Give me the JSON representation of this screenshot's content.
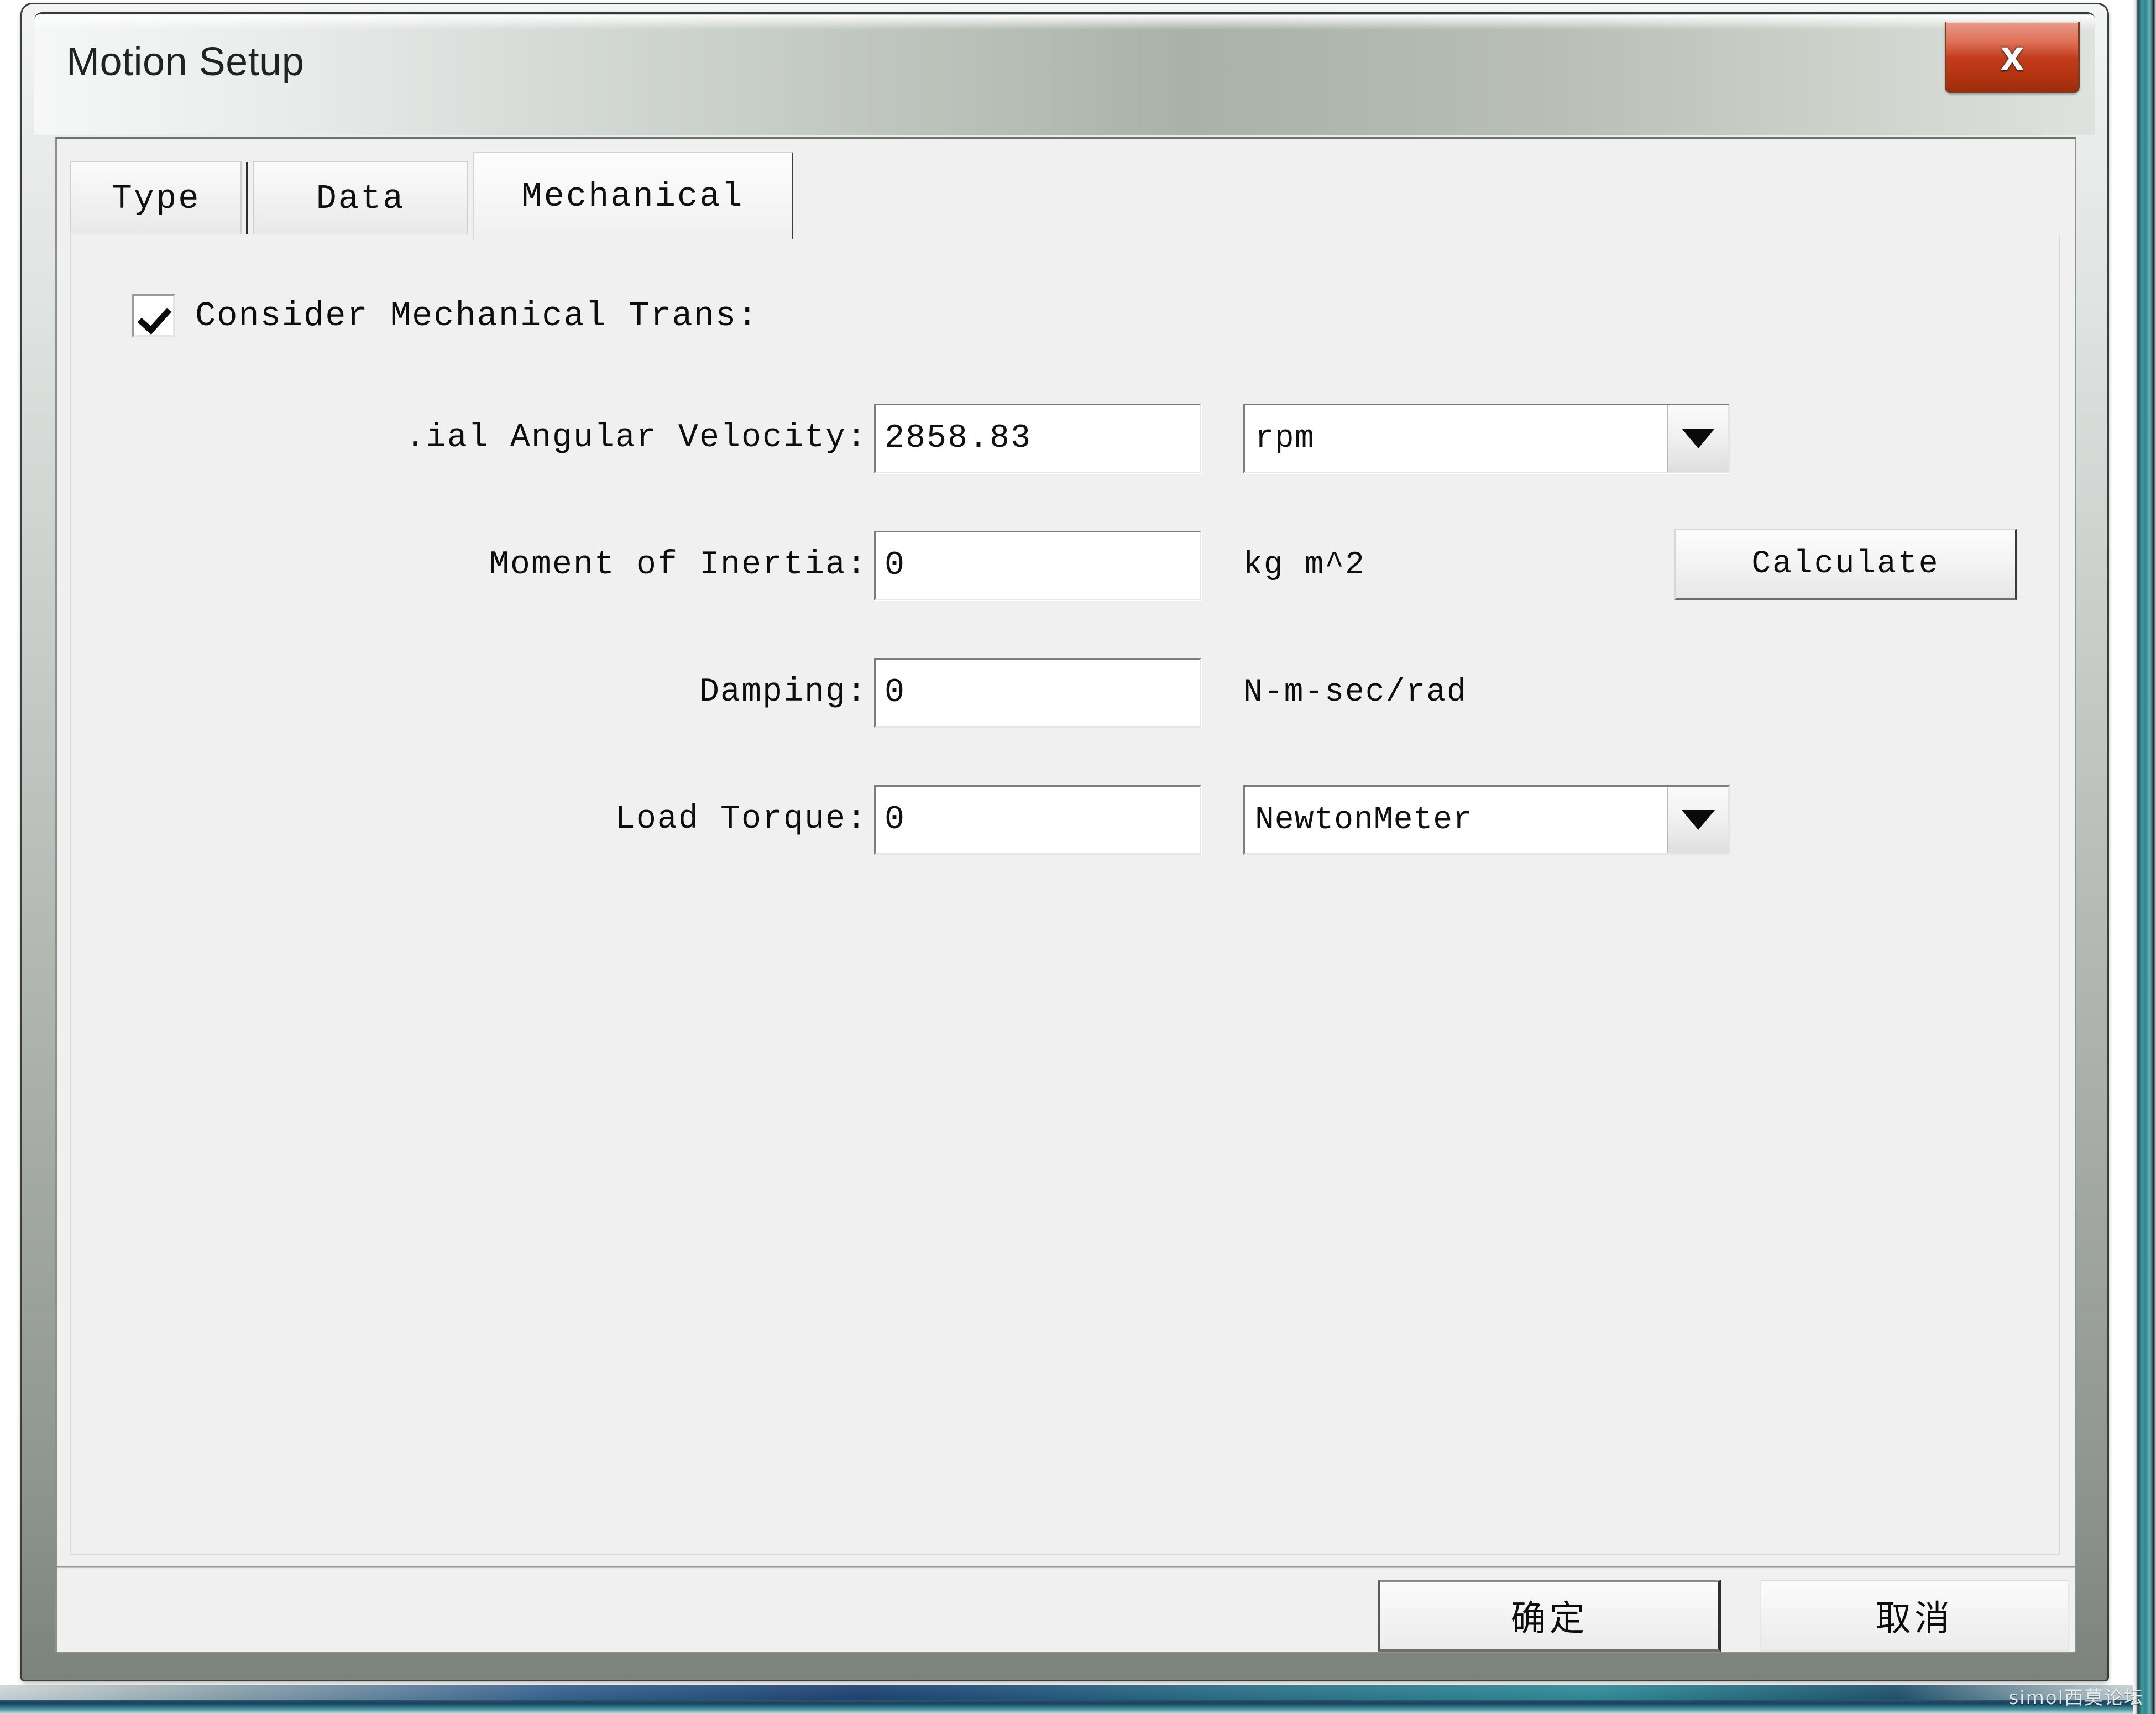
{
  "window": {
    "title": "Motion Setup",
    "close_glyph": "x",
    "close_label": "Close"
  },
  "tabs": [
    {
      "label": "Type",
      "active": false
    },
    {
      "label": "Data",
      "active": false
    },
    {
      "label": "Mechanical",
      "active": true
    }
  ],
  "mechanical": {
    "consider_checkbox": {
      "label": "Consider Mechanical Trans:",
      "checked": true
    },
    "rows": [
      {
        "label": ".ial Angular Velocity:",
        "value": "2858.83",
        "unit_kind": "combo",
        "unit": "rpm"
      },
      {
        "label": "Moment of Inertia:",
        "value": "0",
        "unit_kind": "text",
        "unit": "kg m^2"
      },
      {
        "label": "Damping:",
        "value": "0",
        "unit_kind": "text",
        "unit": "N-m-sec/rad"
      },
      {
        "label": "Load Torque:",
        "value": "0",
        "unit_kind": "combo",
        "unit": "NewtonMeter"
      }
    ],
    "calculate_label": "Calculate"
  },
  "footer": {
    "ok_label": "确定",
    "cancel_label": "取消"
  },
  "watermark": {
    "text": "simol西莫论坛"
  },
  "colors": {
    "close_red": "#c33c1c",
    "dialog_face": "#f0f0f0",
    "title_text": "#1f2326",
    "desktop_teal": "#2f8791"
  }
}
